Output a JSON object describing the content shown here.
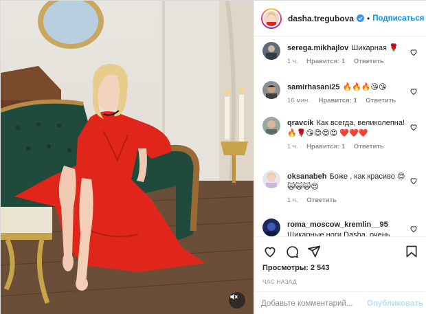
{
  "post": {
    "username": "dasha.tregubova",
    "follow_label": "Подписаться",
    "separator": "•"
  },
  "comments": [
    {
      "user": "serega.mikhajlov",
      "text": "Шикарная 🌹",
      "time": "1 ч.",
      "likes": "Нравится: 1",
      "reply": "Ответить"
    },
    {
      "user": "samirhasani25",
      "text": "🔥🔥🔥😘😘",
      "time": "16 мин.",
      "likes": "Нравится: 1",
      "reply": "Ответить"
    },
    {
      "user": "qravcik",
      "text": "Как всегда, великолепна! 🔥🌹😘😍😍😍 ❤️❤️❤️",
      "time": "1 ч.",
      "likes": "Нравится: 1",
      "reply": "Ответить"
    },
    {
      "user": "oksanabeh",
      "text": "Боже , как красиво 😍🙀🙀🙀😍",
      "time": "1 ч.",
      "likes": "",
      "reply": "Ответить"
    },
    {
      "user": "roma_moscow_kremlin__95",
      "text": "Шикарные ноги Dasha, очень",
      "time": "",
      "likes": "",
      "reply": ""
    }
  ],
  "stats": {
    "views": "Просмотры: 2 543",
    "time_ago": "ЧАС НАЗАД"
  },
  "composer": {
    "placeholder": "Добавьте комментарий...",
    "publish_label": "Опубликовать"
  },
  "colors": {
    "accent": "#0095f6",
    "publish_disabled": "#b2dffc",
    "dress": "#e0261b",
    "sofa": "#1f4a3c"
  },
  "icons": [
    "verified-badge-icon",
    "heart-icon",
    "comment-icon",
    "share-icon",
    "bookmark-icon",
    "mute-icon"
  ]
}
